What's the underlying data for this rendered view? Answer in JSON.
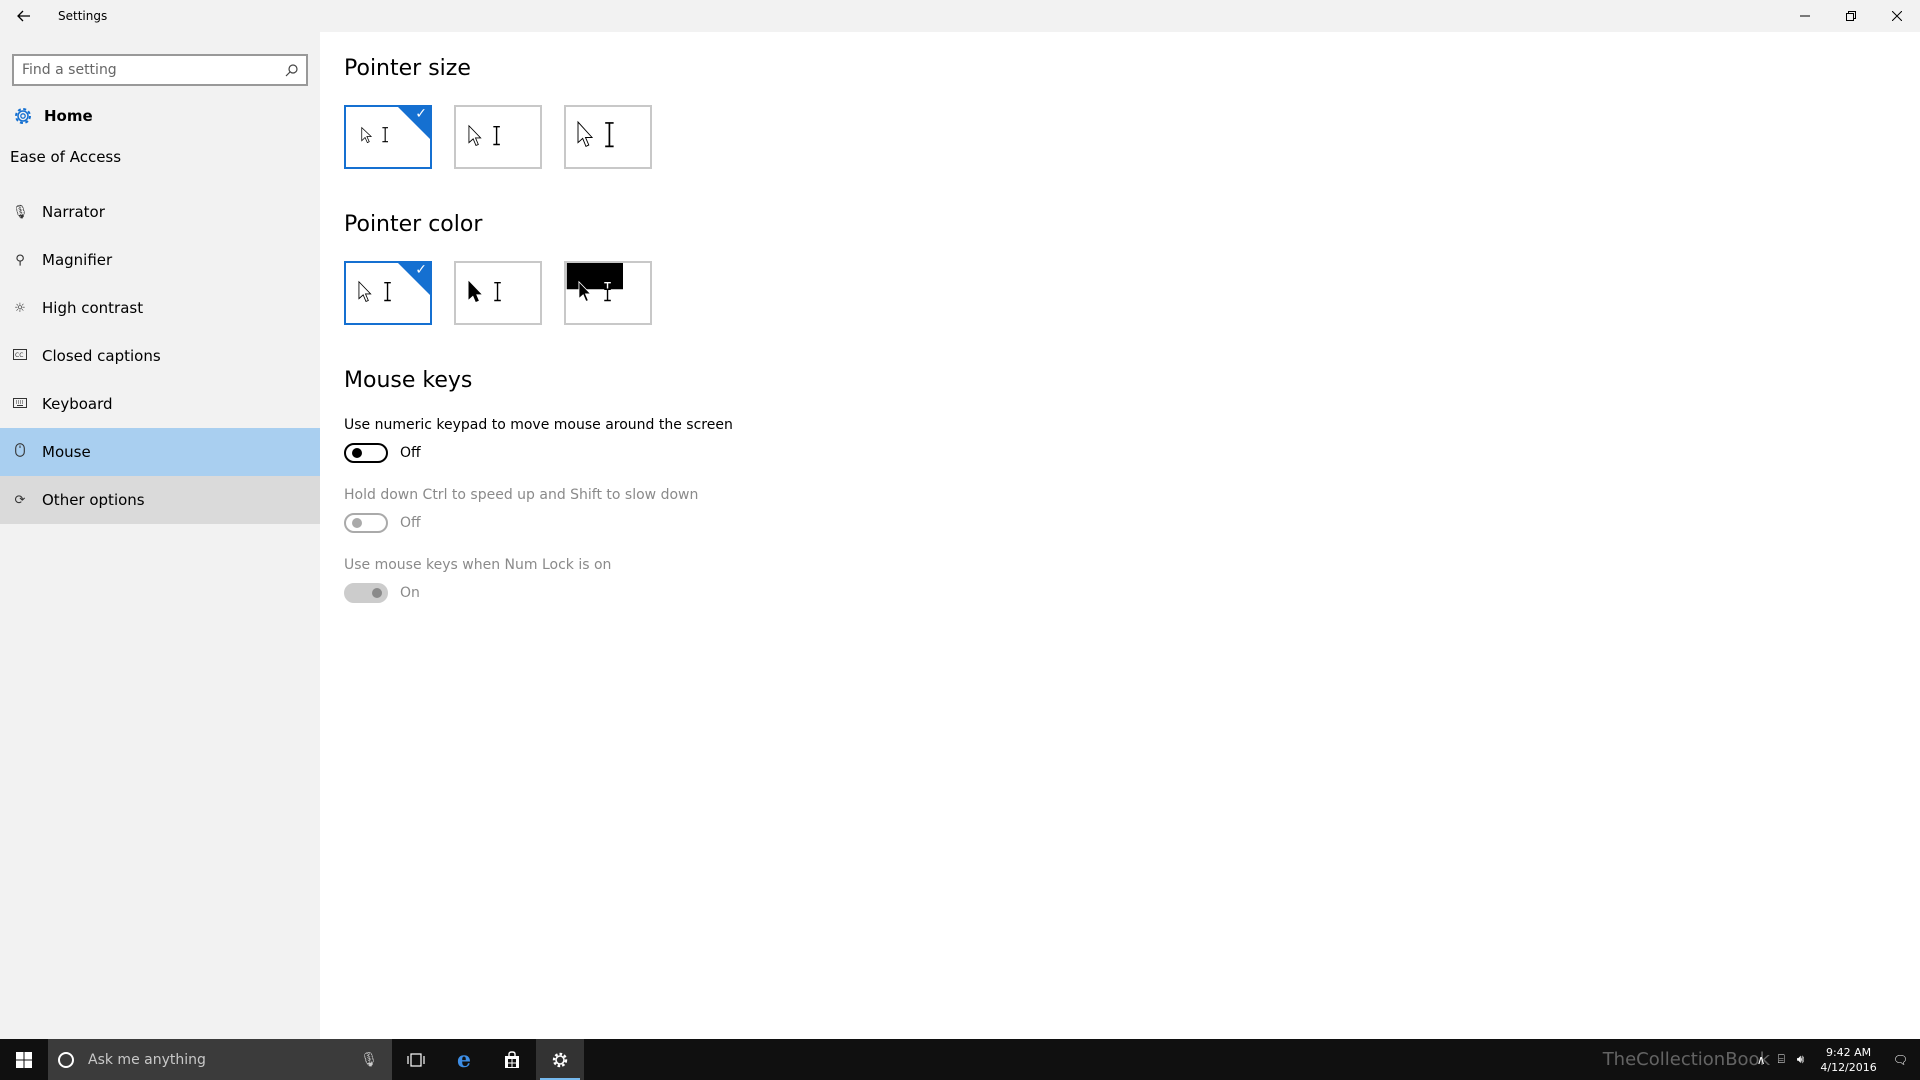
{
  "window": {
    "title": "Settings"
  },
  "sidebar": {
    "search_placeholder": "Find a setting",
    "home_label": "Home",
    "section_label": "Ease of Access",
    "items": [
      {
        "label": "Narrator",
        "icon": "microphone-icon"
      },
      {
        "label": "Magnifier",
        "icon": "magnifier-icon"
      },
      {
        "label": "High contrast",
        "icon": "brightness-icon"
      },
      {
        "label": "Closed captions",
        "icon": "captions-icon"
      },
      {
        "label": "Keyboard",
        "icon": "keyboard-icon"
      },
      {
        "label": "Mouse",
        "icon": "mouse-icon",
        "selected": true
      },
      {
        "label": "Other options",
        "icon": "options-icon",
        "hovered": true
      }
    ]
  },
  "main": {
    "pointer_size": {
      "heading": "Pointer size",
      "options": [
        "small",
        "medium",
        "large"
      ],
      "selected_index": 0
    },
    "pointer_color": {
      "heading": "Pointer color",
      "options": [
        "white",
        "black",
        "inverted"
      ],
      "selected_index": 0
    },
    "mouse_keys": {
      "heading": "Mouse keys",
      "toggles": [
        {
          "desc": "Use numeric keypad to move mouse around the screen",
          "state": "Off",
          "enabled": true
        },
        {
          "desc": "Hold down Ctrl to speed up and Shift to slow down",
          "state": "Off",
          "enabled": false
        },
        {
          "desc": "Use mouse keys when Num Lock is on",
          "state": "On",
          "enabled": false
        }
      ]
    }
  },
  "taskbar": {
    "search_placeholder": "Ask me anything",
    "time": "9:42 AM",
    "date": "4/12/2016",
    "watermark": "TheCollectionBook"
  },
  "colors": {
    "accent": "#1570d1",
    "selected_nav": "#a9cff0",
    "sidebar_bg": "#f2f2f2",
    "taskbar_bg": "#101010"
  }
}
